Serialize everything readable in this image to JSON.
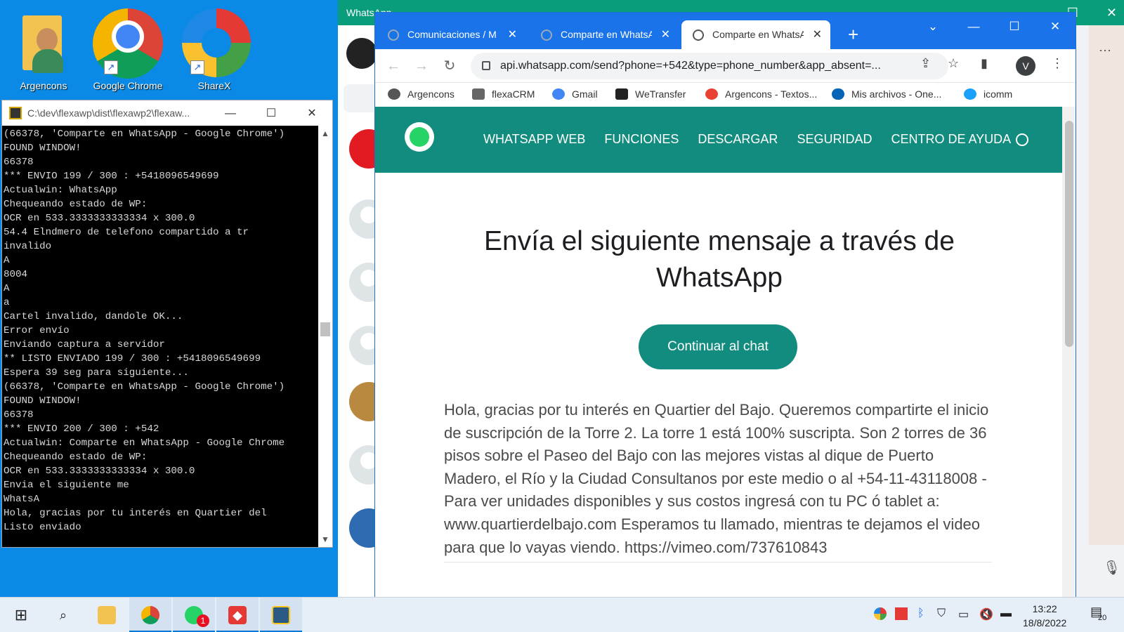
{
  "desktop": {
    "icons": [
      {
        "label": "Argencons"
      },
      {
        "label": "Google Chrome"
      },
      {
        "label": "ShareX"
      }
    ]
  },
  "whatsapp_bg": {
    "title": "WhatsApp"
  },
  "console": {
    "title": "C:\\dev\\flexawp\\dist\\flexawp2\\flexaw...",
    "text": "(66378, 'Comparte en WhatsApp - Google Chrome')\nFOUND WINDOW!\n66378\n*** ENVIO 199 / 300 : +5418096549699\nActualwin: WhatsApp\nChequeando estado de WP:\nOCR en 533.3333333333334 x 300.0\n54.4 Elndmero de telefono compartido a tr\ninvalido\nA\n8004\nA\na\nCartel invalido, dandole OK...\nError envío\nEnviando captura a servidor\n** LISTO ENVIADO 199 / 300 : +5418096549699\nEspera 39 seg para siguiente...\n(66378, 'Comparte en WhatsApp - Google Chrome')\nFOUND WINDOW!\n66378\n*** ENVIO 200 / 300 : +542\nActualwin: Comparte en WhatsApp - Google Chrome\nChequeando estado de WP:\nOCR en 533.3333333333334 x 300.0\nEnvia el siguiente me\nWhatsA\nHola, gracias por tu interés en Quartier del\nListo enviado"
  },
  "chrome": {
    "tabs": [
      {
        "label": "Comunicaciones / M"
      },
      {
        "label": "Comparte en WhatsA"
      },
      {
        "label": "Comparte en WhatsA"
      }
    ],
    "url": "api.whatsapp.com/send?phone=+542&type=phone_number&app_absent=...",
    "profile_initial": "V",
    "bookmarks": [
      {
        "label": "Argencons",
        "color": "#555555"
      },
      {
        "label": "flexaCRM",
        "color": "#666666"
      },
      {
        "label": "Gmail",
        "color": "#4285f4"
      },
      {
        "label": "WeTransfer",
        "color": "#222222"
      },
      {
        "label": "Argencons - Textos...",
        "color": "#e94235"
      },
      {
        "label": "Mis archivos - One...",
        "color": "#0364b8"
      },
      {
        "label": "icomm",
        "color": "#18a0fb"
      }
    ]
  },
  "site": {
    "nav": [
      "WHATSAPP WEB",
      "FUNCIONES",
      "DESCARGAR",
      "SEGURIDAD",
      "CENTRO DE AYUDA"
    ],
    "headline": "Envía el siguiente mensaje a través de WhatsApp",
    "cta": "Continuar al chat",
    "message": "Hola, gracias por tu interés en Quartier del Bajo. Queremos compartirte el inicio de suscripción de la Torre 2. La torre 1 está 100% suscripta. Son 2 torres de 36 pisos sobre el Paseo del Bajo con las mejores vistas al dique de Puerto Madero, el Río y la Ciudad Consultanos por este medio o al +54-11-43118008 - Para ver unidades disponibles y sus costos ingresá con tu PC ó tablet a: www.quartierdelbajo.com Esperamos tu llamado, mientras te dejamos el video para que lo vayas viendo. https://vimeo.com/737610843"
  },
  "taskbar": {
    "whatsapp_badge": "1",
    "time": "13:22",
    "date": "18/8/2022",
    "notifications": "20"
  },
  "colors": {
    "desktop": "#0a8ae6",
    "whatsapp_green": "#128c7e",
    "chrome_blue": "#1a73e8"
  }
}
